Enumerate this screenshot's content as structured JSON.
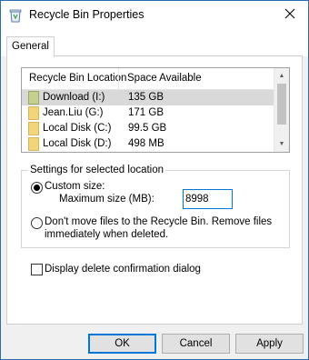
{
  "window": {
    "title": "Recycle Bin Properties",
    "icon": "recycle-bin-icon",
    "close_icon": "close-icon"
  },
  "tabs": [
    {
      "label": "General",
      "active": true
    }
  ],
  "list": {
    "headers": [
      "Recycle Bin Location",
      "Space Available"
    ],
    "rows": [
      {
        "location": "Download (I:)",
        "space": "135 GB",
        "icon": "folder-icon",
        "selected": true
      },
      {
        "location": "Jean.Liu (G:)",
        "space": "171 GB",
        "icon": "folder-icon",
        "selected": false
      },
      {
        "location": "Local Disk (C:)",
        "space": "99.5 GB",
        "icon": "folder-icon",
        "selected": false
      },
      {
        "location": "Local Disk (D:)",
        "space": "498 MB",
        "icon": "folder-icon",
        "selected": false
      }
    ]
  },
  "settings": {
    "legend": "Settings for selected location",
    "custom_size_label": "Custom size:",
    "custom_size_checked": true,
    "max_size_label": "Maximum size (MB):",
    "max_size_value": "8998",
    "dont_move_line1": "Don't move files to the Recycle Bin. Remove files",
    "dont_move_line2": "immediately when deleted.",
    "dont_move_checked": false
  },
  "confirm_dialog": {
    "label": "Display delete confirmation dialog",
    "checked": false
  },
  "buttons": {
    "ok": "OK",
    "cancel": "Cancel",
    "apply": "Apply"
  },
  "colors": {
    "accent": "#0078d7",
    "selection": "#d9d9d9",
    "window_border": "#2b6cb0"
  }
}
